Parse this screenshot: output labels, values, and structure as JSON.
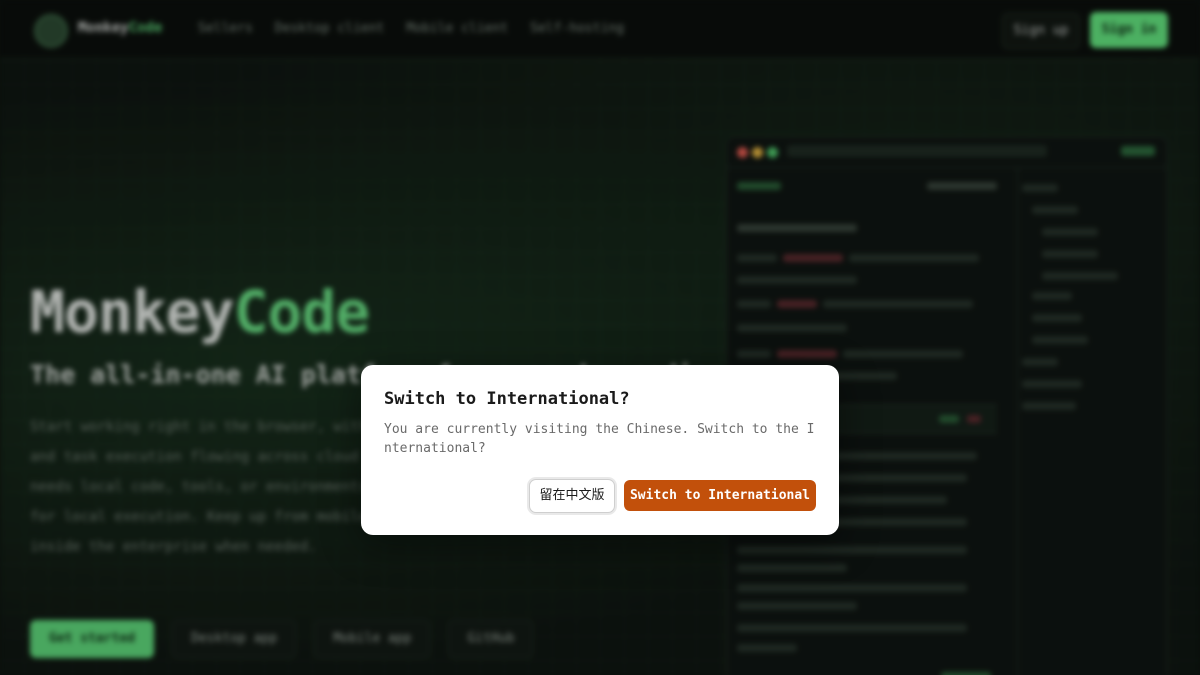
{
  "background": {
    "nav": {
      "brand_primary": "Monkey",
      "brand_accent": "Code",
      "links": [
        "Sellers",
        "Desktop client",
        "Mobile client",
        "Self-hosting"
      ],
      "sign_up": "Sign up",
      "sign_in": "Sign in"
    },
    "hero": {
      "title_primary": "Monkey",
      "title_accent": "Code",
      "subtitle": "The all-in-one AI platform for everyday coding",
      "paragraph": "Start working right in the browser, with AI-driven development, and task execution flowing across cloud workspaces. When work needs local code, tools, or environments, hand it to MonkeyWork for local execution. Keep up from mobile, and deploy privately inside the enterprise when needed.",
      "buttons": [
        "Get started",
        "Desktop app",
        "Mobile app",
        "GitHub"
      ]
    }
  },
  "dialog": {
    "title": "Switch to International?",
    "message": "You are currently visiting the Chinese. Switch to the International?",
    "stay_button": "留在中文版",
    "switch_button": "Switch to International"
  },
  "colors": {
    "accent_green": "#5fd37a",
    "switch_button_bg": "#c2500b",
    "dialog_bg": "#ffffff"
  }
}
